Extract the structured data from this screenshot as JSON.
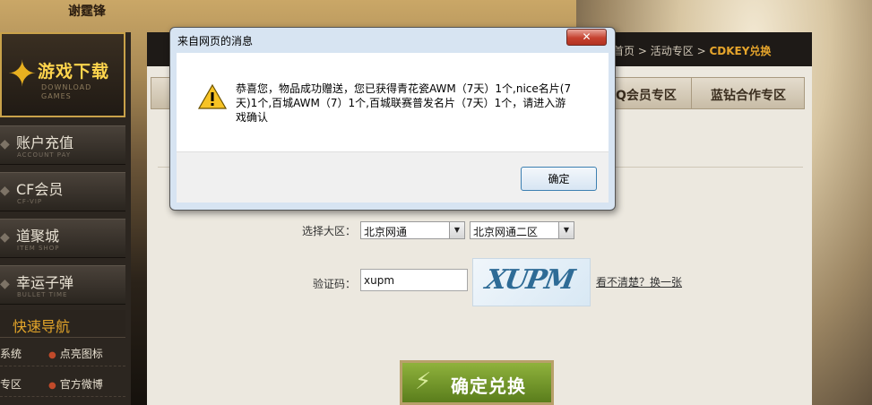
{
  "page": {
    "top_title": "谢霆锋"
  },
  "sidebar": {
    "download": {
      "title": "游戏下载",
      "sub1": "DOWNLOAD",
      "sub2": "GAMES"
    },
    "items": [
      {
        "label": "账户充值",
        "sub": "ACCOUNT PAY"
      },
      {
        "label": "CF会员",
        "sub": "CF-VIP"
      },
      {
        "label": "道聚城",
        "sub": "ITEM SHOP"
      },
      {
        "label": "幸运子弹",
        "sub": "BULLET TIME"
      }
    ],
    "quick_nav": "快速导航",
    "quick_rows": [
      {
        "a": "系统",
        "b": "点亮图标"
      },
      {
        "a": "专区",
        "b": "官方微博"
      }
    ]
  },
  "breadcrumb": {
    "home": "首页",
    "sep": ">",
    "section": "活动专区",
    "current": "CDKEY兑换"
  },
  "tabs": [
    "Q会员专区",
    "蓝钻合作专区"
  ],
  "form": {
    "region_label": "选择大区：",
    "region1": "北京网通",
    "region2": "北京网通二区",
    "captcha_label": "验证码：",
    "captcha_value": "xupm",
    "captcha_image_text": "XUPM",
    "refresh_link": "看不清楚？换一张",
    "redeem_button": "确定兑换"
  },
  "dialog": {
    "title": "来自网页的消息",
    "close": "✕",
    "message": "恭喜您，物品成功赠送，您已获得青花瓷AWM（7天）1个,nice名片(7天)1个,百城AWM（7）1个,百城联赛普发名片（7天）1个，请进入游戏确认",
    "ok": "确定"
  },
  "colors": {
    "accent": "#e6a52c",
    "dialog_frame": "#d7e4f2",
    "redeem_green": "#6d9428"
  }
}
